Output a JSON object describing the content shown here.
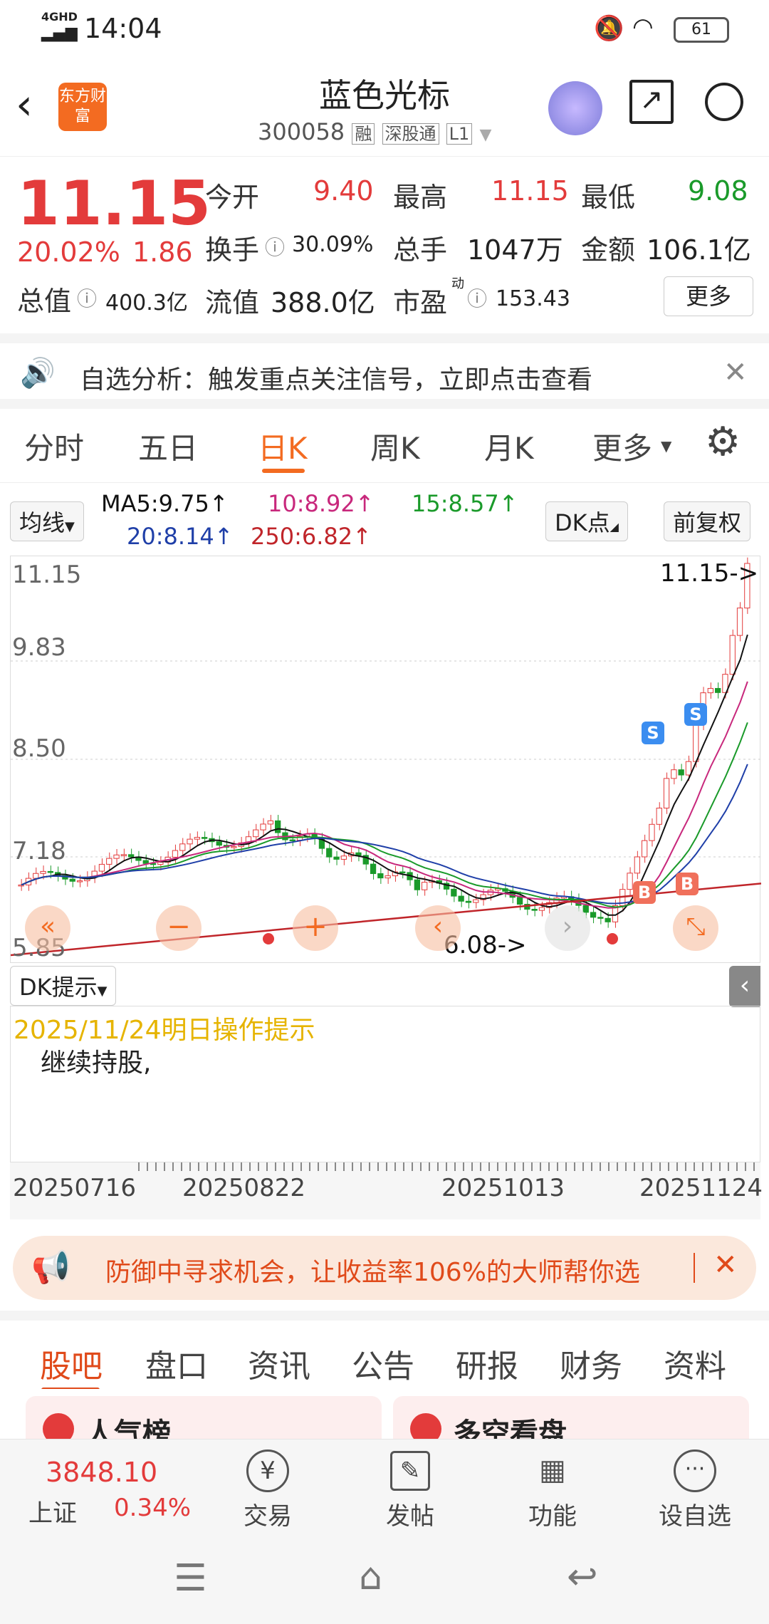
{
  "status_bar": {
    "network": "4GHD",
    "time": "14:04",
    "battery": "61"
  },
  "header": {
    "logo": "东方财富",
    "stock_name": "蓝色光标",
    "stock_code": "300058",
    "tags": [
      "融",
      "深股通",
      "L1"
    ]
  },
  "quote": {
    "price": "11.15",
    "change_pct": "20.02%",
    "change": "1.86",
    "open_label": "今开",
    "open": "9.40",
    "high_label": "最高",
    "high": "11.15",
    "low_label": "最低",
    "low": "9.08",
    "turnover_label": "换手",
    "turnover": "30.09%",
    "volume_label": "总手",
    "volume": "1047万",
    "amount_label": "金额",
    "amount": "106.1亿",
    "mktcap_label": "总值",
    "mktcap": "400.3亿",
    "float_label": "流值",
    "float": "388.0亿",
    "pe_label": "市盈",
    "pe_sup": "动",
    "pe": "153.43",
    "more": "更多"
  },
  "alert": {
    "text": "自选分析：触发重点关注信号，立即点击查看"
  },
  "tabs": [
    "分时",
    "五日",
    "日K",
    "周K",
    "月K",
    "更多"
  ],
  "ma": {
    "selector": "均线",
    "ma5": "MA5:9.75↑",
    "ma10": "10:8.92↑",
    "ma15": "15:8.57↑",
    "ma20": "20:8.14↑",
    "ma250": "250:6.82↑",
    "dk": "DK点",
    "adjust": "前复权"
  },
  "chart_data": {
    "type": "candlestick",
    "y_ticks": [
      "11.15",
      "9.83",
      "8.50",
      "7.18",
      "5.85"
    ],
    "ylim": [
      5.85,
      11.15
    ],
    "high_annotation": "11.15->",
    "low_annotation": "6.08->",
    "signals": [
      "S",
      "S",
      "B",
      "B"
    ],
    "x_ticks": [
      "20250716",
      "20250822",
      "20251013",
      "20251124"
    ],
    "colors": {
      "up": "#e33b3b",
      "down": "#1a9a2a",
      "ma5": "#111111",
      "ma10": "#c8287c",
      "ma15": "#1a9a2a",
      "ma20": "#1f3fa8",
      "ma250": "#c0252a"
    }
  },
  "dk": {
    "label": "DK提示",
    "date_line": "2025/11/24明日操作提示",
    "advice": "继续持股,"
  },
  "promo": {
    "text": "防御中寻求机会，让收益率106%的大师帮你选"
  },
  "bottom_tabs": [
    "股吧",
    "盘口",
    "资讯",
    "公告",
    "研报",
    "财务",
    "资料"
  ],
  "cards": [
    "人气榜",
    "多空看盘"
  ],
  "index": {
    "value": "3848.10",
    "name": "上证",
    "pct": "0.34%"
  },
  "nav": [
    "交易",
    "发帖",
    "功能",
    "设自选"
  ]
}
